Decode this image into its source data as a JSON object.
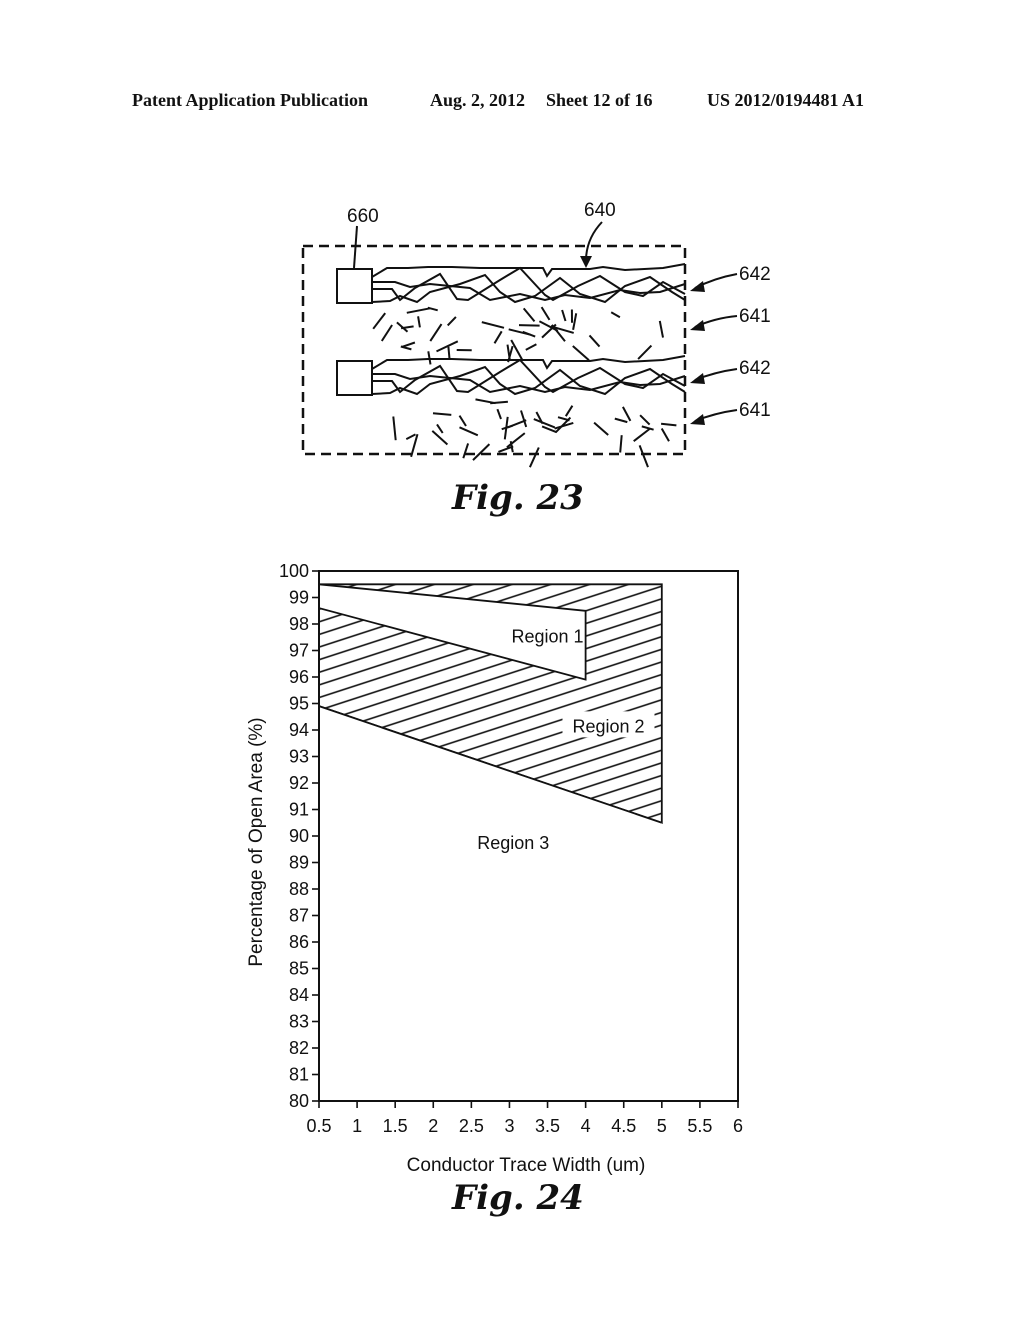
{
  "header": {
    "publication": "Patent Application Publication",
    "date": "Aug. 2, 2012",
    "sheet": "Sheet 12 of 16",
    "number": "US 2012/0194481 A1"
  },
  "fig23": {
    "caption": "Fig. 23",
    "labels": {
      "pad": "660",
      "pattern": "640",
      "trace_top": "642",
      "nanowire_top": "641",
      "trace_bottom": "642",
      "nanowire_bottom": "641"
    }
  },
  "fig24": {
    "caption": "Fig. 24"
  },
  "chart_data": {
    "type": "area",
    "title": "",
    "xlabel": "Conductor Trace Width (um)",
    "ylabel": "Percentage of Open Area (%)",
    "xlim": [
      0.5,
      6
    ],
    "ylim": [
      80,
      100
    ],
    "xticks": [
      "0.5",
      "1",
      "1.5",
      "2",
      "2.5",
      "3",
      "3.5",
      "4",
      "4.5",
      "5",
      "5.5",
      "6"
    ],
    "yticks": [
      "80",
      "81",
      "82",
      "83",
      "84",
      "85",
      "86",
      "87",
      "88",
      "89",
      "90",
      "91",
      "92",
      "93",
      "94",
      "95",
      "96",
      "97",
      "98",
      "99",
      "100"
    ],
    "grid": false,
    "regions": [
      {
        "name": "Region 1",
        "fill": "white",
        "polygon": [
          [
            0.5,
            99.5
          ],
          [
            4,
            98.5
          ],
          [
            4,
            95.9
          ],
          [
            0.5,
            98.6
          ]
        ]
      },
      {
        "name": "Region 2",
        "fill": "hatched",
        "polygon": [
          [
            0.5,
            99.5
          ],
          [
            5,
            99.5
          ],
          [
            5,
            90.5
          ],
          [
            0.5,
            94.9
          ]
        ]
      },
      {
        "name": "Region 3",
        "fill": "white",
        "polygon": [
          [
            0.5,
            94.9
          ],
          [
            5,
            90.5
          ],
          [
            5,
            80
          ],
          [
            0.5,
            80
          ]
        ]
      }
    ],
    "annotations": [
      {
        "text": "Region 1",
        "x": 3.5,
        "y": 97.5
      },
      {
        "text": "Region 2",
        "x": 4.3,
        "y": 94.1
      },
      {
        "text": "Region 3",
        "x": 3.05,
        "y": 89.7
      }
    ]
  }
}
